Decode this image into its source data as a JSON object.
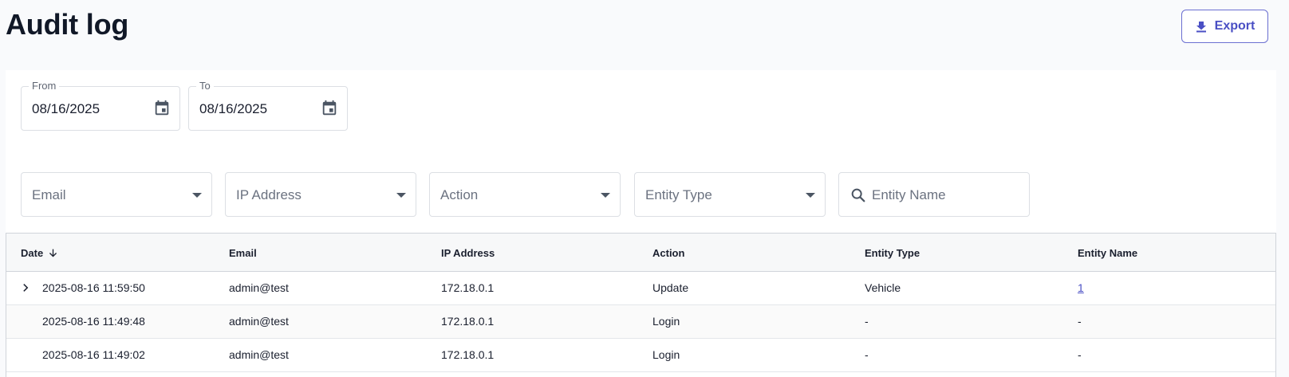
{
  "header": {
    "title": "Audit log",
    "export_label": "Export",
    "export_icon": "download-icon"
  },
  "filters": {
    "from": {
      "label": "From",
      "value": "08/16/2025"
    },
    "to": {
      "label": "To",
      "value": "08/16/2025"
    },
    "email_placeholder": "Email",
    "ip_placeholder": "IP Address",
    "action_placeholder": "Action",
    "entity_type_placeholder": "Entity Type",
    "entity_name_placeholder": "Entity Name"
  },
  "table": {
    "columns": [
      "Date",
      "Email",
      "IP Address",
      "Action",
      "Entity Type",
      "Entity Name"
    ],
    "sort": {
      "column": "Date",
      "direction": "desc"
    },
    "rows": [
      {
        "date": "2025-08-16 11:59:50",
        "email": "admin@test",
        "ip": "172.18.0.1",
        "action": "Update",
        "entity_type": "Vehicle",
        "entity_name": "1",
        "expandable": true
      },
      {
        "date": "2025-08-16 11:49:48",
        "email": "admin@test",
        "ip": "172.18.0.1",
        "action": "Login",
        "entity_type": "-",
        "entity_name": "-",
        "expandable": false
      },
      {
        "date": "2025-08-16 11:49:02",
        "email": "admin@test",
        "ip": "172.18.0.1",
        "action": "Login",
        "entity_type": "-",
        "entity_name": "-",
        "expandable": false
      }
    ]
  },
  "colors": {
    "accent": "#4a4fc4",
    "page_bg": "#f9fafc"
  }
}
